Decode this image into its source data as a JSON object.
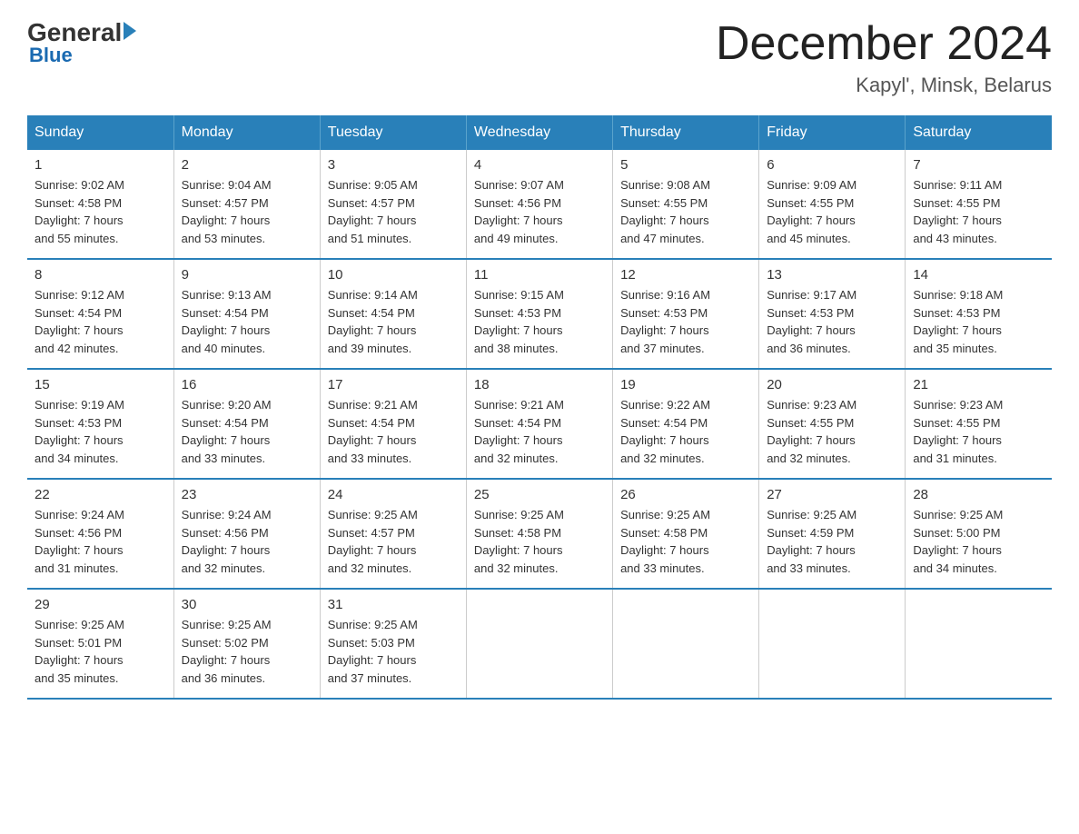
{
  "header": {
    "month_title": "December 2024",
    "location": "Kapyl', Minsk, Belarus",
    "logo_general": "General",
    "logo_blue": "Blue"
  },
  "days_of_week": [
    "Sunday",
    "Monday",
    "Tuesday",
    "Wednesday",
    "Thursday",
    "Friday",
    "Saturday"
  ],
  "weeks": [
    [
      {
        "num": "1",
        "sunrise": "9:02 AM",
        "sunset": "4:58 PM",
        "daylight": "7 hours and 55 minutes."
      },
      {
        "num": "2",
        "sunrise": "9:04 AM",
        "sunset": "4:57 PM",
        "daylight": "7 hours and 53 minutes."
      },
      {
        "num": "3",
        "sunrise": "9:05 AM",
        "sunset": "4:57 PM",
        "daylight": "7 hours and 51 minutes."
      },
      {
        "num": "4",
        "sunrise": "9:07 AM",
        "sunset": "4:56 PM",
        "daylight": "7 hours and 49 minutes."
      },
      {
        "num": "5",
        "sunrise": "9:08 AM",
        "sunset": "4:55 PM",
        "daylight": "7 hours and 47 minutes."
      },
      {
        "num": "6",
        "sunrise": "9:09 AM",
        "sunset": "4:55 PM",
        "daylight": "7 hours and 45 minutes."
      },
      {
        "num": "7",
        "sunrise": "9:11 AM",
        "sunset": "4:55 PM",
        "daylight": "7 hours and 43 minutes."
      }
    ],
    [
      {
        "num": "8",
        "sunrise": "9:12 AM",
        "sunset": "4:54 PM",
        "daylight": "7 hours and 42 minutes."
      },
      {
        "num": "9",
        "sunrise": "9:13 AM",
        "sunset": "4:54 PM",
        "daylight": "7 hours and 40 minutes."
      },
      {
        "num": "10",
        "sunrise": "9:14 AM",
        "sunset": "4:54 PM",
        "daylight": "7 hours and 39 minutes."
      },
      {
        "num": "11",
        "sunrise": "9:15 AM",
        "sunset": "4:53 PM",
        "daylight": "7 hours and 38 minutes."
      },
      {
        "num": "12",
        "sunrise": "9:16 AM",
        "sunset": "4:53 PM",
        "daylight": "7 hours and 37 minutes."
      },
      {
        "num": "13",
        "sunrise": "9:17 AM",
        "sunset": "4:53 PM",
        "daylight": "7 hours and 36 minutes."
      },
      {
        "num": "14",
        "sunrise": "9:18 AM",
        "sunset": "4:53 PM",
        "daylight": "7 hours and 35 minutes."
      }
    ],
    [
      {
        "num": "15",
        "sunrise": "9:19 AM",
        "sunset": "4:53 PM",
        "daylight": "7 hours and 34 minutes."
      },
      {
        "num": "16",
        "sunrise": "9:20 AM",
        "sunset": "4:54 PM",
        "daylight": "7 hours and 33 minutes."
      },
      {
        "num": "17",
        "sunrise": "9:21 AM",
        "sunset": "4:54 PM",
        "daylight": "7 hours and 33 minutes."
      },
      {
        "num": "18",
        "sunrise": "9:21 AM",
        "sunset": "4:54 PM",
        "daylight": "7 hours and 32 minutes."
      },
      {
        "num": "19",
        "sunrise": "9:22 AM",
        "sunset": "4:54 PM",
        "daylight": "7 hours and 32 minutes."
      },
      {
        "num": "20",
        "sunrise": "9:23 AM",
        "sunset": "4:55 PM",
        "daylight": "7 hours and 32 minutes."
      },
      {
        "num": "21",
        "sunrise": "9:23 AM",
        "sunset": "4:55 PM",
        "daylight": "7 hours and 31 minutes."
      }
    ],
    [
      {
        "num": "22",
        "sunrise": "9:24 AM",
        "sunset": "4:56 PM",
        "daylight": "7 hours and 31 minutes."
      },
      {
        "num": "23",
        "sunrise": "9:24 AM",
        "sunset": "4:56 PM",
        "daylight": "7 hours and 32 minutes."
      },
      {
        "num": "24",
        "sunrise": "9:25 AM",
        "sunset": "4:57 PM",
        "daylight": "7 hours and 32 minutes."
      },
      {
        "num": "25",
        "sunrise": "9:25 AM",
        "sunset": "4:58 PM",
        "daylight": "7 hours and 32 minutes."
      },
      {
        "num": "26",
        "sunrise": "9:25 AM",
        "sunset": "4:58 PM",
        "daylight": "7 hours and 33 minutes."
      },
      {
        "num": "27",
        "sunrise": "9:25 AM",
        "sunset": "4:59 PM",
        "daylight": "7 hours and 33 minutes."
      },
      {
        "num": "28",
        "sunrise": "9:25 AM",
        "sunset": "5:00 PM",
        "daylight": "7 hours and 34 minutes."
      }
    ],
    [
      {
        "num": "29",
        "sunrise": "9:25 AM",
        "sunset": "5:01 PM",
        "daylight": "7 hours and 35 minutes."
      },
      {
        "num": "30",
        "sunrise": "9:25 AM",
        "sunset": "5:02 PM",
        "daylight": "7 hours and 36 minutes."
      },
      {
        "num": "31",
        "sunrise": "9:25 AM",
        "sunset": "5:03 PM",
        "daylight": "7 hours and 37 minutes."
      },
      {
        "num": "",
        "sunrise": "",
        "sunset": "",
        "daylight": ""
      },
      {
        "num": "",
        "sunrise": "",
        "sunset": "",
        "daylight": ""
      },
      {
        "num": "",
        "sunrise": "",
        "sunset": "",
        "daylight": ""
      },
      {
        "num": "",
        "sunrise": "",
        "sunset": "",
        "daylight": ""
      }
    ]
  ],
  "labels": {
    "sunrise": "Sunrise:",
    "sunset": "Sunset:",
    "daylight": "Daylight:"
  }
}
